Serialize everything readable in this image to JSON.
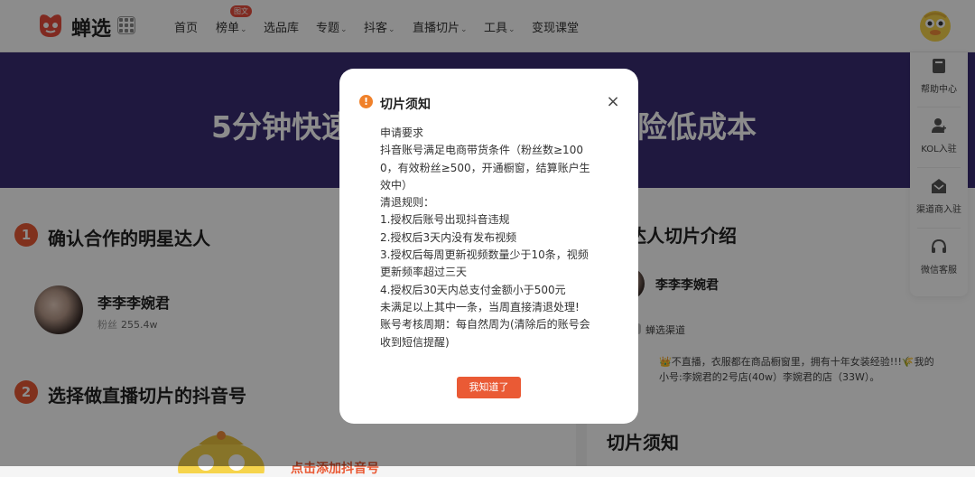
{
  "nav": {
    "brand": "蝉选",
    "badge": "图文",
    "items": [
      {
        "label": "首页",
        "dropdown": false
      },
      {
        "label": "榜单",
        "dropdown": true
      },
      {
        "label": "选品库",
        "dropdown": false
      },
      {
        "label": "专题",
        "dropdown": true
      },
      {
        "label": "抖客",
        "dropdown": true
      },
      {
        "label": "直播切片",
        "dropdown": true
      },
      {
        "label": "工具",
        "dropdown": true
      },
      {
        "label": "变现课堂",
        "dropdown": false
      }
    ],
    "caret": "⌄"
  },
  "banner": {
    "left": "5分钟快速",
    "right": "险低成本"
  },
  "left": {
    "step1": {
      "num": "1",
      "title": "确认合作的明星达人"
    },
    "influencer": {
      "name": "李李李婉君",
      "fans_label": "粉丝",
      "fans_value": "255.4w"
    },
    "step2": {
      "num": "2",
      "title": "选择做直播切片的抖音号"
    },
    "promo": "点击添加抖音号"
  },
  "right": {
    "title": "播达人切片介绍",
    "name": "李李李婉君",
    "channel": "蝉选渠道",
    "intro": "👑不直播，衣服都在商品橱窗里，拥有十年女装经验!!!🌾我的小号:李婉君的2号店(40w）李婉君的店（33W）。",
    "bottom_title": "切片须知"
  },
  "sidebar": [
    {
      "label": "帮助中心",
      "icon": "book-icon"
    },
    {
      "label": "KOL入驻",
      "icon": "user-plus-icon"
    },
    {
      "label": "渠道商入驻",
      "icon": "mail-icon"
    },
    {
      "label": "微信客服",
      "icon": "headset-icon"
    }
  ],
  "modal": {
    "icon": "!",
    "title": "切片须知",
    "close": "×",
    "lines": [
      "申请要求",
      "抖音账号满足电商带货条件（粉丝数≥100",
      "0，有效粉丝≥500，开通橱窗，结算账户生",
      "效中）",
      "清退规则：",
      "1.授权后账号出现抖音违规",
      "2.授权后3天内没有发布视频",
      "3.授权后每周更新视频数量少于10条，视频",
      "更新频率超过三天",
      "4.授权后30天内总支付金额小于500元",
      "未满足以上其中一条，当周直接清退处理!",
      "账号考核周期：每自然周为(清除后的账号会",
      "收到短信提醒)"
    ],
    "button": "我知道了"
  },
  "colors": {
    "accent": "#ea5a35",
    "banner": "#3a2d74",
    "warn": "#f0812a"
  }
}
